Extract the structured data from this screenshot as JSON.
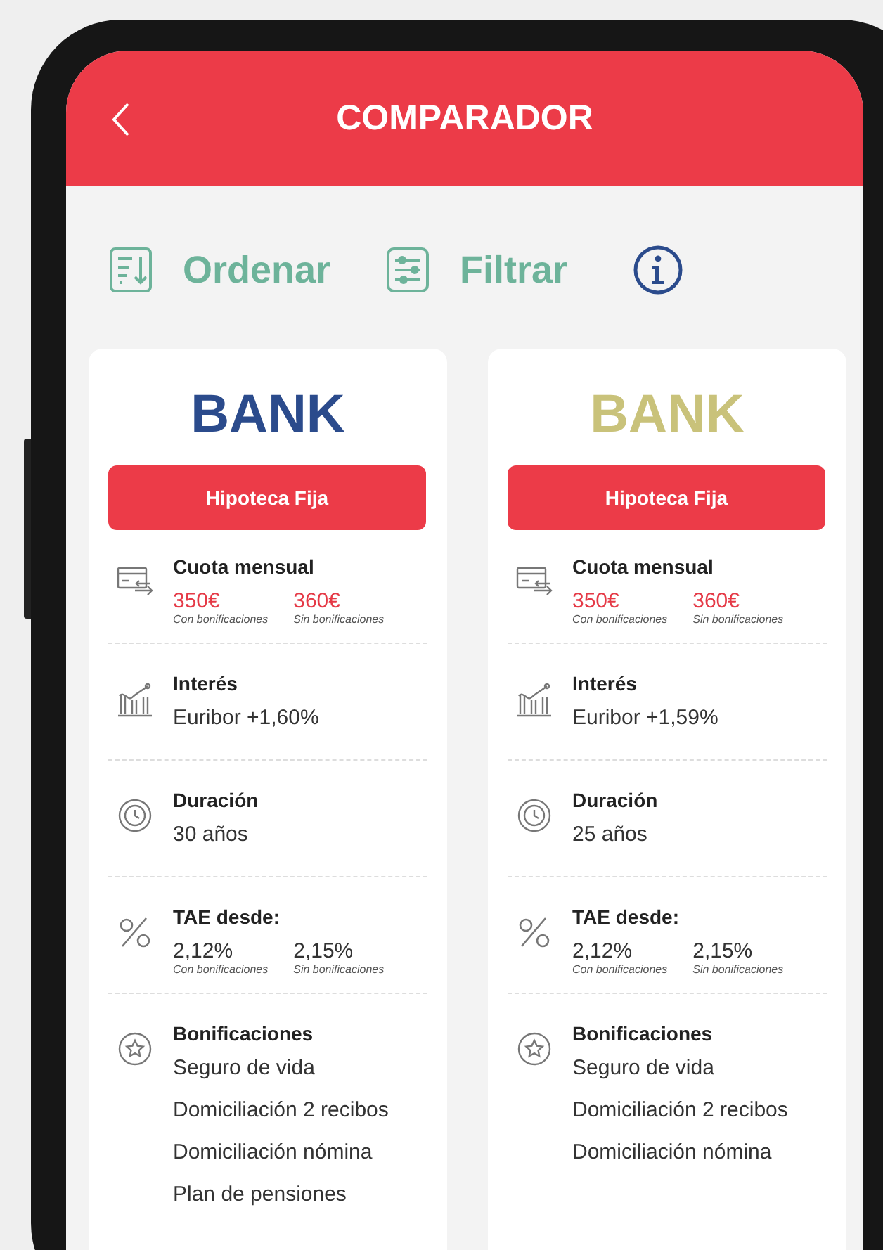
{
  "header": {
    "title": "COMPARADOR"
  },
  "toolbar": {
    "sort_label": "Ordenar",
    "filter_label": "Filtrar"
  },
  "offers": [
    {
      "bank": "BANK",
      "color": "#2b4b8c",
      "product": "Hipoteca Fija",
      "rows": [
        {
          "kind": "payment",
          "label": "Cuota mensual",
          "values": [
            {
              "value": "350€",
              "note": "Con bonificaciones"
            },
            {
              "value": "360€",
              "note": "Sin bonificaciones"
            }
          ]
        },
        {
          "kind": "interest",
          "label": "Interés",
          "text": "Euribor +1,60%"
        },
        {
          "kind": "duration",
          "label": "Duración",
          "text": "30 años"
        },
        {
          "kind": "rate",
          "label": "TAE desde:",
          "values": [
            {
              "value": "2,12%",
              "note": "Con bonificaciones"
            },
            {
              "value": "2,15%",
              "note": "Sin bonificaciones"
            }
          ]
        },
        {
          "kind": "bonus",
          "label": "Bonificaciones",
          "items": [
            "Seguro de vida",
            "Domiciliación 2 recibos",
            "Domiciliación nómina",
            "Plan de pensiones"
          ]
        }
      ]
    },
    {
      "bank": "BANK",
      "color": "#c9c27a",
      "product": "Hipoteca Fija",
      "rows": [
        {
          "kind": "payment",
          "label": "Cuota mensual",
          "values": [
            {
              "value": "350€",
              "note": "Con bonificaciones"
            },
            {
              "value": "360€",
              "note": "Sin bonificaciones"
            }
          ]
        },
        {
          "kind": "interest",
          "label": "Interés",
          "text": "Euribor +1,59%"
        },
        {
          "kind": "duration",
          "label": "Duración",
          "text": "25 años"
        },
        {
          "kind": "rate",
          "label": "TAE desde:",
          "values": [
            {
              "value": "2,12%",
              "note": "Con bonificaciones"
            },
            {
              "value": "2,15%",
              "note": "Sin bonificaciones"
            }
          ]
        },
        {
          "kind": "bonus",
          "label": "Bonificaciones",
          "items": [
            "Seguro de vida",
            "Domiciliación 2 recibos",
            "Domiciliación nómina"
          ]
        }
      ]
    }
  ]
}
